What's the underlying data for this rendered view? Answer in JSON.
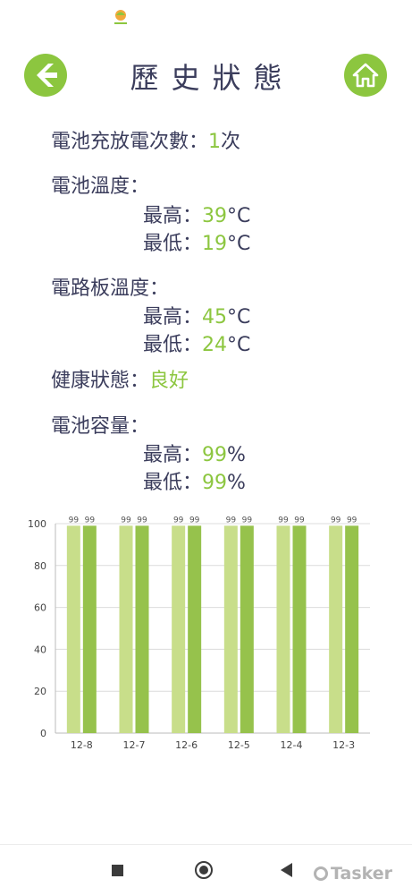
{
  "header": {
    "title": "歷史狀態"
  },
  "stats": {
    "charge_cycles": {
      "label": "電池充放電次數：",
      "value": "1",
      "unit": "次"
    },
    "battery_temp": {
      "label": "電池溫度：",
      "max_label": "最高：",
      "max_value": "39",
      "max_unit": "°C",
      "min_label": "最低：",
      "min_value": "19",
      "min_unit": "°C"
    },
    "board_temp": {
      "label": "電路板溫度：",
      "max_label": "最高：",
      "max_value": "45",
      "max_unit": "°C",
      "min_label": "最低：",
      "min_value": "24",
      "min_unit": "°C"
    },
    "health": {
      "label": "健康狀態：",
      "value": "良好"
    },
    "capacity": {
      "label": "電池容量：",
      "max_label": "最高：",
      "max_value": "99",
      "max_unit": "%",
      "min_label": "最低：",
      "min_value": "99",
      "min_unit": "%"
    }
  },
  "chart_data": {
    "type": "bar",
    "categories": [
      "12-8",
      "12-7",
      "12-6",
      "12-5",
      "12-4",
      "12-3"
    ],
    "series": [
      {
        "values": [
          99,
          99,
          99,
          99,
          99,
          99
        ],
        "color": "#c8de8a"
      },
      {
        "values": [
          99,
          99,
          99,
          99,
          99,
          99
        ],
        "color": "#96c24c"
      }
    ],
    "ylim": [
      0,
      100
    ],
    "yticks": [
      0,
      20,
      40,
      60,
      80,
      100
    ],
    "grid": true
  },
  "footer": {
    "watermark": "Tasker"
  },
  "colors": {
    "accent": "#8cc63f",
    "text": "#3b3d5c"
  }
}
